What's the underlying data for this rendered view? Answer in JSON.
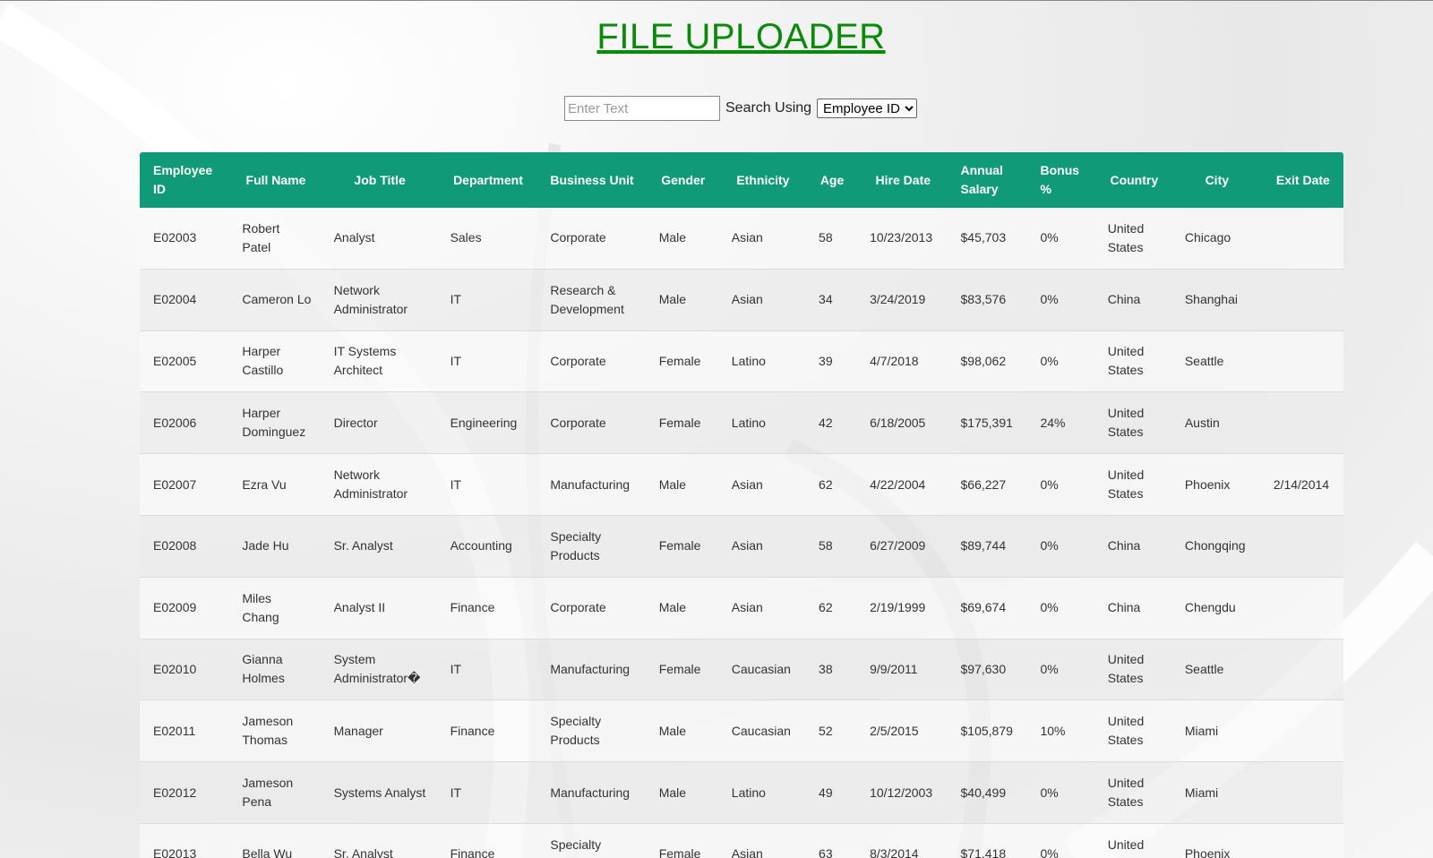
{
  "page": {
    "title": "FILE UPLOADER",
    "colors": {
      "title": "#0a8a0a",
      "header_bg": "#119a78",
      "header_text": "#ffffff"
    }
  },
  "search": {
    "placeholder": "Enter Text",
    "label": "Search Using",
    "selected": "Employee ID"
  },
  "table": {
    "headers": [
      "Employee ID",
      "Full Name",
      "Job Title",
      "Department",
      "Business Unit",
      "Gender",
      "Ethnicity",
      "Age",
      "Hire Date",
      "Annual Salary",
      "Bonus %",
      "Country",
      "City",
      "Exit Date"
    ],
    "rows": [
      [
        "E02003",
        "Robert Patel",
        "Analyst",
        "Sales",
        "Corporate",
        "Male",
        "Asian",
        "58",
        "10/23/2013",
        "$45,703",
        "0%",
        "United States",
        "Chicago",
        ""
      ],
      [
        "E02004",
        "Cameron Lo",
        "Network Administrator",
        "IT",
        "Research & Development",
        "Male",
        "Asian",
        "34",
        "3/24/2019",
        "$83,576",
        "0%",
        "China",
        "Shanghai",
        ""
      ],
      [
        "E02005",
        "Harper Castillo",
        "IT Systems Architect",
        "IT",
        "Corporate",
        "Female",
        "Latino",
        "39",
        "4/7/2018",
        "$98,062",
        "0%",
        "United States",
        "Seattle",
        ""
      ],
      [
        "E02006",
        "Harper Dominguez",
        "Director",
        "Engineering",
        "Corporate",
        "Female",
        "Latino",
        "42",
        "6/18/2005",
        "$175,391",
        "24%",
        "United States",
        "Austin",
        ""
      ],
      [
        "E02007",
        "Ezra Vu",
        "Network Administrator",
        "IT",
        "Manufacturing",
        "Male",
        "Asian",
        "62",
        "4/22/2004",
        "$66,227",
        "0%",
        "United States",
        "Phoenix",
        "2/14/2014"
      ],
      [
        "E02008",
        "Jade Hu",
        "Sr. Analyst",
        "Accounting",
        "Specialty Products",
        "Female",
        "Asian",
        "58",
        "6/27/2009",
        "$89,744",
        "0%",
        "China",
        "Chongqing",
        ""
      ],
      [
        "E02009",
        "Miles Chang",
        "Analyst II",
        "Finance",
        "Corporate",
        "Male",
        "Asian",
        "62",
        "2/19/1999",
        "$69,674",
        "0%",
        "China",
        "Chengdu",
        ""
      ],
      [
        "E02010",
        "Gianna Holmes",
        "System Administrator�",
        "IT",
        "Manufacturing",
        "Female",
        "Caucasian",
        "38",
        "9/9/2011",
        "$97,630",
        "0%",
        "United States",
        "Seattle",
        ""
      ],
      [
        "E02011",
        "Jameson Thomas",
        "Manager",
        "Finance",
        "Specialty Products",
        "Male",
        "Caucasian",
        "52",
        "2/5/2015",
        "$105,879",
        "10%",
        "United States",
        "Miami",
        ""
      ],
      [
        "E02012",
        "Jameson Pena",
        "Systems Analyst",
        "IT",
        "Manufacturing",
        "Male",
        "Latino",
        "49",
        "10/12/2003",
        "$40,499",
        "0%",
        "United States",
        "Miami",
        ""
      ],
      [
        "E02013",
        "Bella Wu",
        "Sr. Analyst",
        "Finance",
        "Specialty Products",
        "Female",
        "Asian",
        "63",
        "8/3/2014",
        "$71,418",
        "0%",
        "United States",
        "Phoenix",
        ""
      ]
    ]
  }
}
